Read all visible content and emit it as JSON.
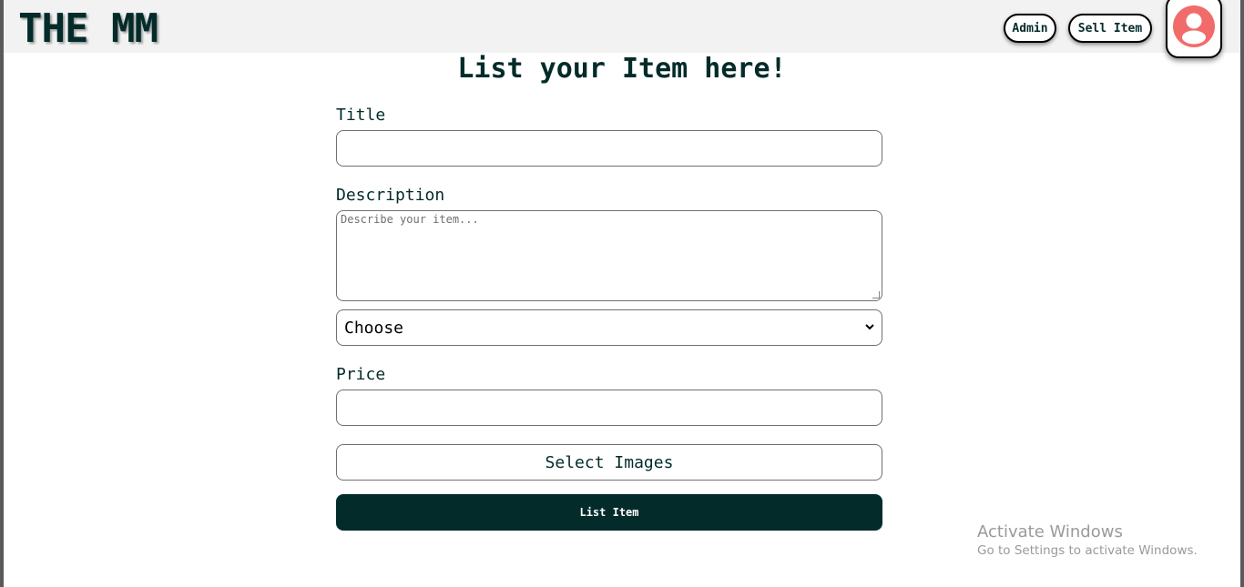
{
  "header": {
    "logo": "THE MM",
    "admin_label": "Admin",
    "sell_label": "Sell Item",
    "avatar_icon": "user-circle-icon",
    "avatar_color": "#f26b6b"
  },
  "form": {
    "heading": "List your Item here!",
    "title_label": "Title",
    "title_value": "",
    "description_label": "Description",
    "description_placeholder": "Describe your item...",
    "category_selected": "Choose",
    "price_label": "Price",
    "price_value": "",
    "select_images_label": "Select Images",
    "submit_label": "List Item"
  },
  "colors": {
    "primary": "#032b2a",
    "navbar_bg": "#f2f2f2"
  },
  "watermark": {
    "title": "Activate Windows",
    "subtitle": "Go to Settings to activate Windows."
  }
}
